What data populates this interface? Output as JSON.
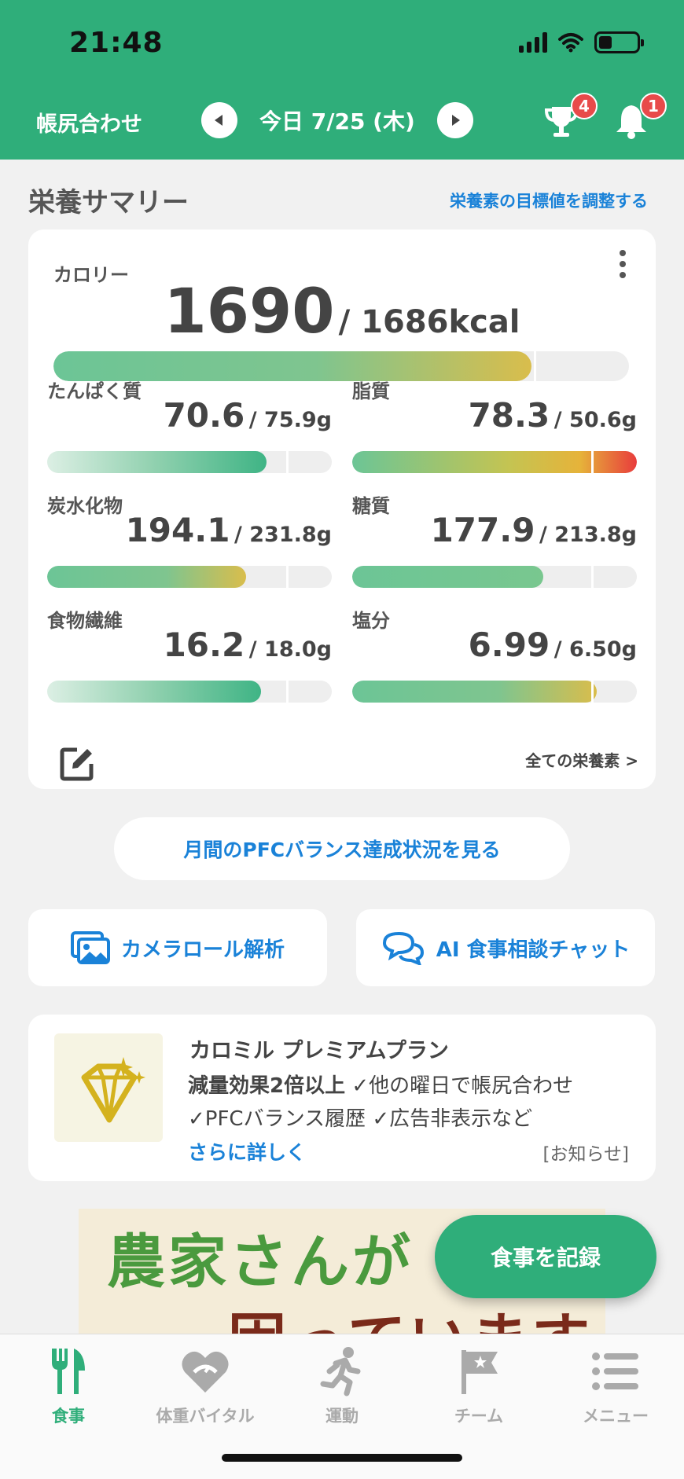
{
  "status_bar": {
    "time": "21:48"
  },
  "header": {
    "left_label": "帳尻合わせ",
    "date": "今日 7/25 (木)",
    "trophy_badge": "4",
    "bell_badge": "1",
    "accent": "#2fae7a"
  },
  "summary": {
    "title": "栄養サマリー",
    "adjust_link": "栄養素の目標値を調整する",
    "calorie": {
      "label": "カロリー",
      "value": "1690",
      "target": "/ 1686kcal",
      "progress": 1.0
    },
    "nutrients": [
      {
        "name": "たんぱく質",
        "value": "70.6",
        "target": "/ 75.9g",
        "progress": 0.93
      },
      {
        "name": "脂質",
        "value": "78.3",
        "target": "/ 50.6g",
        "progress": 1.0
      },
      {
        "name": "炭水化物",
        "value": "194.1",
        "target": "/ 231.8g",
        "progress": 0.84
      },
      {
        "name": "糖質",
        "value": "177.9",
        "target": "/ 213.8g",
        "progress": 0.83
      },
      {
        "name": "食物繊維",
        "value": "16.2",
        "target": "/ 18.0g",
        "progress": 0.9
      },
      {
        "name": "塩分",
        "value": "6.99",
        "target": "/ 6.50g",
        "progress": 1.0
      }
    ],
    "all_link": "全ての栄養素 >"
  },
  "pfc_button": "月間のPFCバランス達成状況を見る",
  "actions": {
    "camera": "カメラロール解析",
    "chat": "AI 食事相談チャット"
  },
  "premium": {
    "title": "カロミル プレミアムプラン",
    "line1_bold": "減量効果2倍以上",
    "line1_rest": " ✓他の曜日で帳尻合わせ",
    "line2": "✓PFCバランス履歴 ✓広告非表示など",
    "more": "さらに詳しく",
    "notice": "[お知らせ]"
  },
  "ad": {
    "line1": "農家さんが",
    "line2": "困っています"
  },
  "record_button": "食事を記録",
  "tabs": [
    {
      "label": "食事",
      "icon": "fork-knife-icon",
      "active": true
    },
    {
      "label": "体重バイタル",
      "icon": "heart-scale-icon",
      "active": false
    },
    {
      "label": "運動",
      "icon": "runner-icon",
      "active": false
    },
    {
      "label": "チーム",
      "icon": "flag-icon",
      "active": false
    },
    {
      "label": "メニュー",
      "icon": "list-icon",
      "active": false
    }
  ]
}
